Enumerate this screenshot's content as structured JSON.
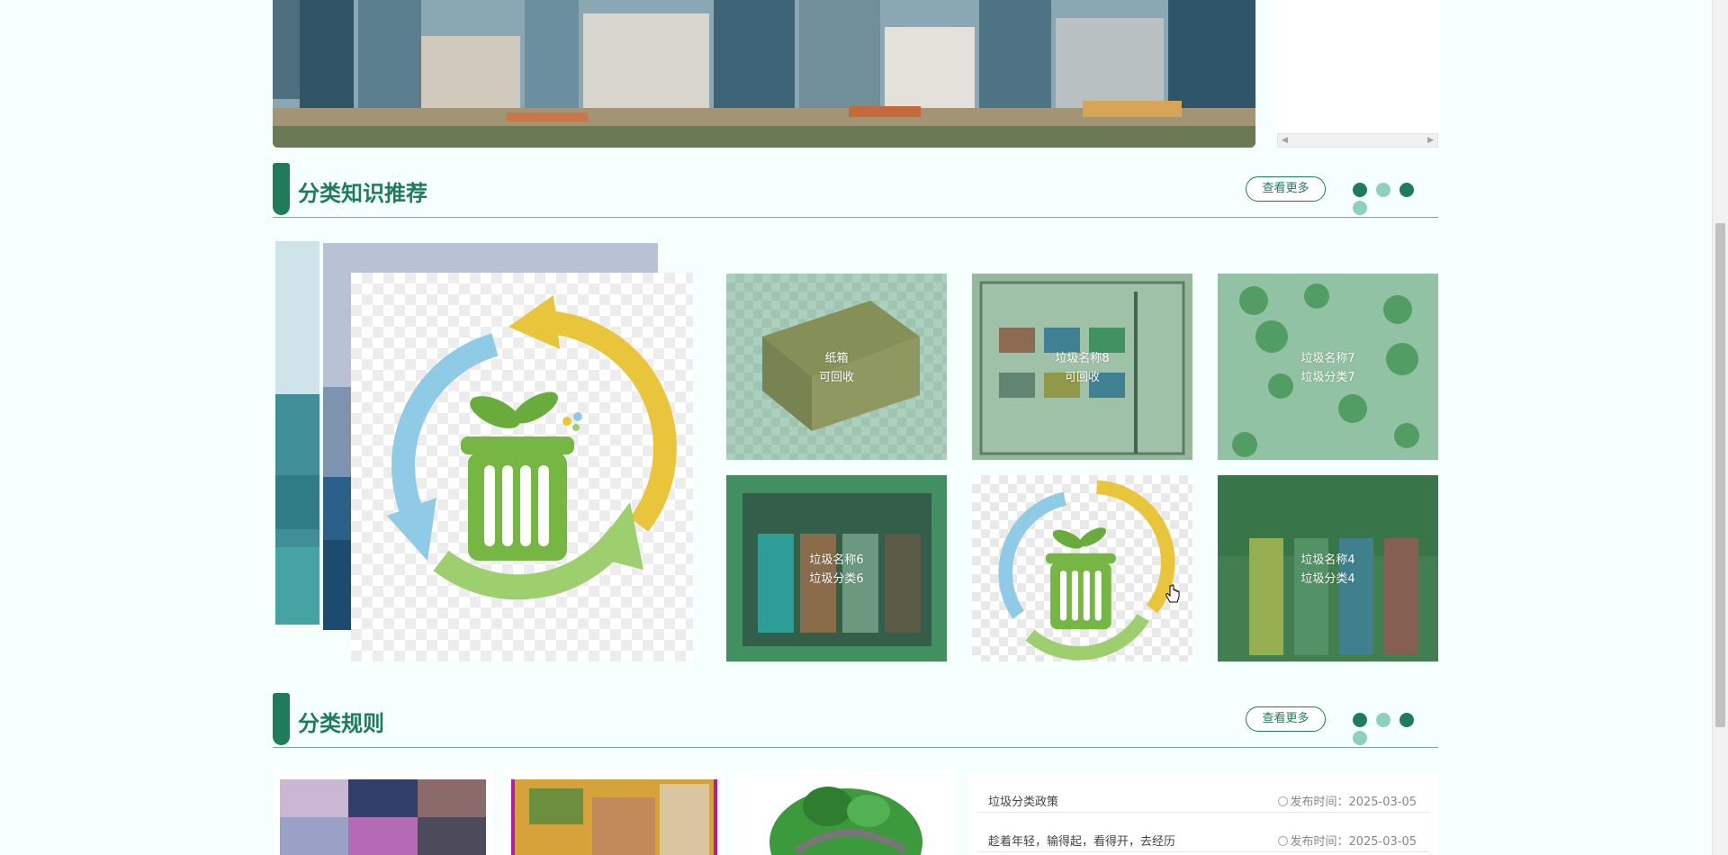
{
  "banner": {
    "scrollbar": {
      "left_icon": "triangle-left-icon",
      "right_icon": "triangle-right-icon"
    }
  },
  "knowledge": {
    "title": "分类知识推荐",
    "more_label": "查看更多",
    "dots": [
      "dark",
      "light",
      "dark",
      "light"
    ],
    "cards": [
      {
        "line1": "纸箱",
        "line2": "可回收"
      },
      {
        "line1": "垃圾名称8",
        "line2": "可回收"
      },
      {
        "line1": "垃圾名称7",
        "line2": "垃圾分类7"
      },
      {
        "line1": "垃圾名称6",
        "line2": "垃圾分类6"
      },
      {
        "line1": "",
        "line2": ""
      },
      {
        "line1": "垃圾名称4",
        "line2": "垃圾分类4"
      }
    ]
  },
  "rules": {
    "title": "分类规则",
    "more_label": "查看更多",
    "dots": [
      "dark",
      "light",
      "dark",
      "light"
    ],
    "news": [
      {
        "title": "垃圾分类政策",
        "date_label": "发布时间：2025-03-05"
      },
      {
        "title": "趁着年轻，输得起，看得开，去经历",
        "date_label": "发布时间：2025-03-05"
      }
    ]
  },
  "colors": {
    "brand_green": "#1f7c5a",
    "dot_light": "#8fd0bd",
    "card_overlay": "rgba(70,150,110,0.45)"
  }
}
